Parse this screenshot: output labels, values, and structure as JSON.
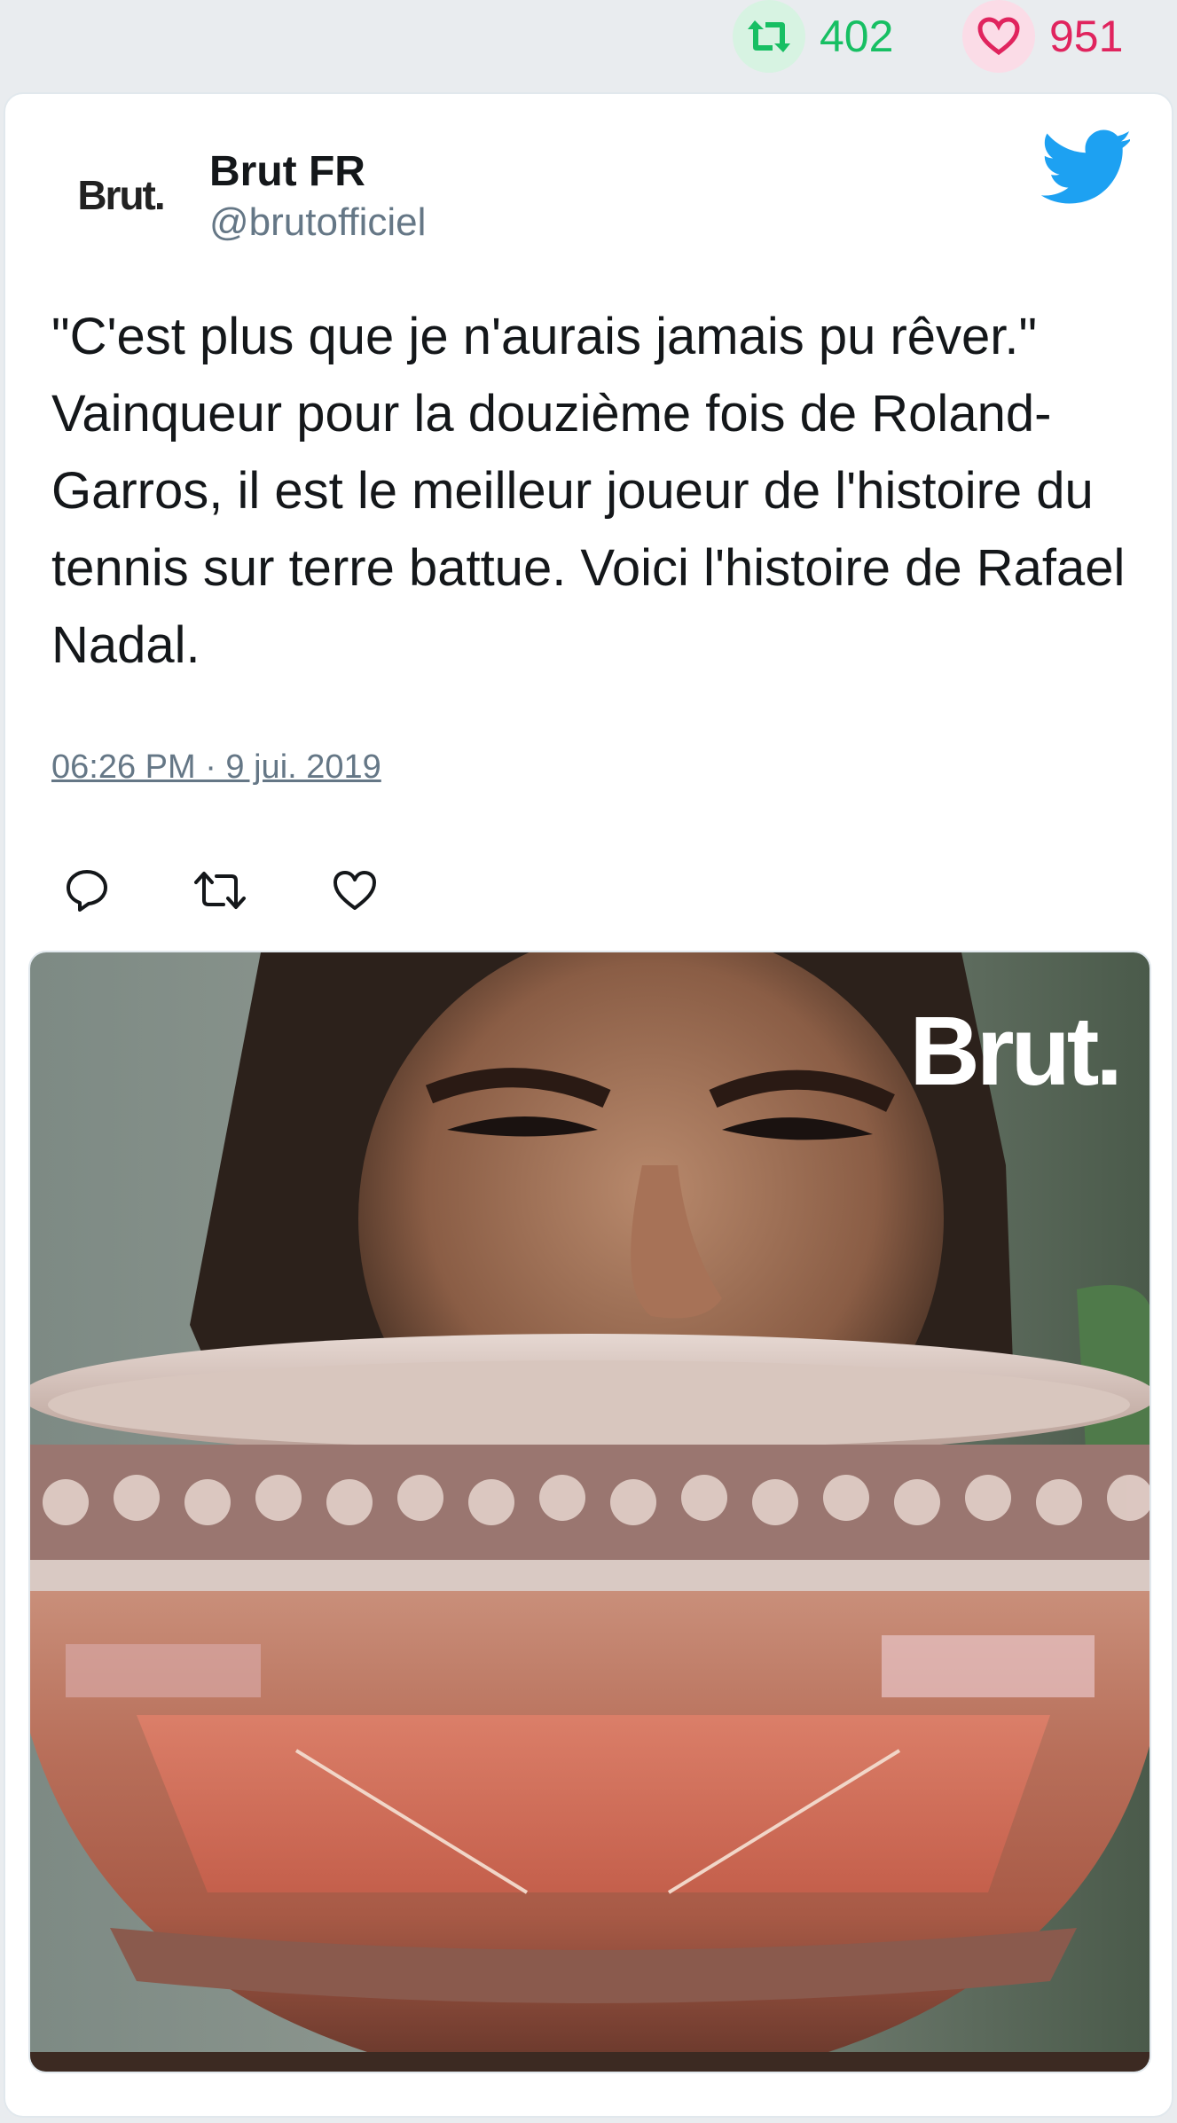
{
  "stats": {
    "retweets": "402",
    "likes": "951"
  },
  "author": {
    "avatar_text": "Brut.",
    "name": "Brut FR",
    "handle": "@brutofficiel"
  },
  "tweet": {
    "text": "\"C'est plus que je n'aurais jamais pu rêver.\" Vainqueur pour la douzième fois de Roland-Garros, il est le meilleur joueur de l'histoire du tennis sur terre battue. Voici l'histoire de Rafael Nadal.",
    "timestamp": "06:26 PM · 9 jui. 2019"
  },
  "media": {
    "watermark": "Brut."
  },
  "colors": {
    "retweet_green": "#17bf63",
    "like_red": "#e0245e",
    "twitter_blue": "#1da1f2",
    "muted_gray": "#657786"
  },
  "icons": {
    "retweet": "retweet-icon",
    "like": "heart-icon",
    "reply": "reply-icon",
    "twitter": "twitter-bird-icon"
  }
}
